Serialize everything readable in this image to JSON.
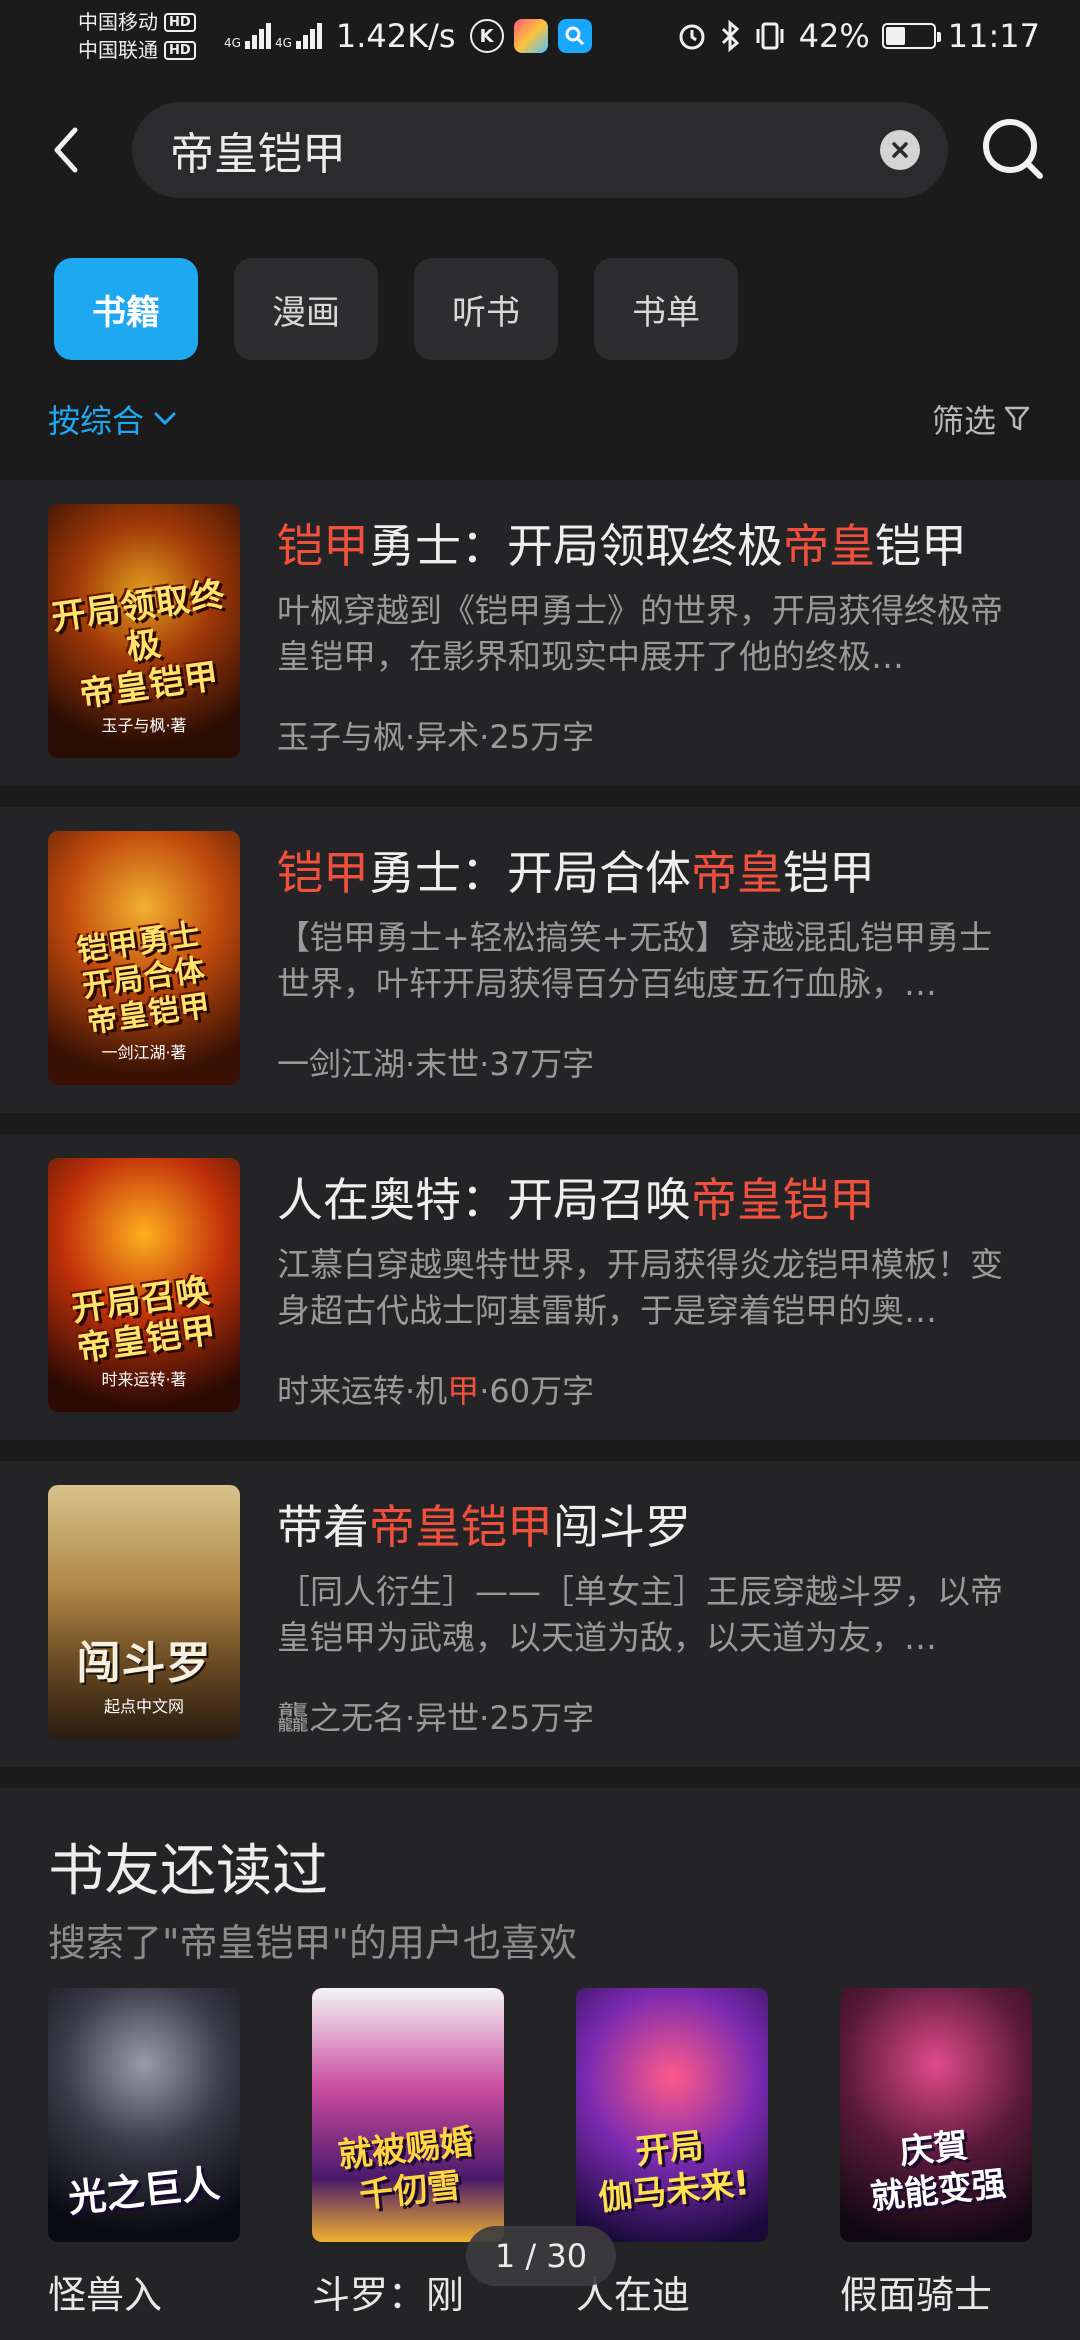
{
  "status_bar": {
    "carrier1": "中国移动",
    "carrier2": "中国联通",
    "hd": "HD",
    "net_type": "4G",
    "net_speed": "1.42K/s",
    "battery_pct": "42%",
    "battery_level": 0.42,
    "time": "11:17"
  },
  "search": {
    "query": "帝皇铠甲"
  },
  "tabs": [
    {
      "label": "书籍"
    },
    {
      "label": "漫画"
    },
    {
      "label": "听书"
    },
    {
      "label": "书单"
    }
  ],
  "sort": {
    "label": "按综合"
  },
  "filter": {
    "label": "筛选"
  },
  "results": [
    {
      "title": [
        {
          "t": "铠甲",
          "hl": true
        },
        {
          "t": "勇士：开局领取终极",
          "hl": false
        },
        {
          "t": "帝皇",
          "hl": true
        },
        {
          "t": "铠甲",
          "hl": false
        }
      ],
      "desc": "叶枫穿越到《铠甲勇士》的世界，开局获得终极帝皇铠甲，在影界和现实中展开了他的终极…",
      "meta": [
        {
          "t": "玉子与枫·异术·25万字",
          "hl": false
        }
      ],
      "cover_text": "开局领取终极\n帝皇铠甲",
      "cover_sub": "玉子与枫·著"
    },
    {
      "title": [
        {
          "t": "铠甲",
          "hl": true
        },
        {
          "t": "勇士：开局合体",
          "hl": false
        },
        {
          "t": "帝皇",
          "hl": true
        },
        {
          "t": "铠甲",
          "hl": false
        }
      ],
      "desc": "【铠甲勇士+轻松搞笑+无敌】穿越混乱铠甲勇士世界，叶轩开局获得百分百纯度五行血脉，…",
      "meta": [
        {
          "t": "一剑江湖·末世·37万字",
          "hl": false
        }
      ],
      "cover_text": "铠甲勇士\n开局合体\n帝皇铠甲",
      "cover_sub": "一剑江湖·著"
    },
    {
      "title": [
        {
          "t": "人在奥特：开局召唤",
          "hl": false
        },
        {
          "t": "帝皇铠甲",
          "hl": true
        }
      ],
      "desc": "江慕白穿越奥特世界，开局获得炎龙铠甲模板！变身超古代战士阿基雷斯，于是穿着铠甲的奥…",
      "meta": [
        {
          "t": "时来运转·机",
          "hl": false
        },
        {
          "t": "甲",
          "hl": true
        },
        {
          "t": "·60万字",
          "hl": false
        }
      ],
      "cover_text": "开局召唤\n帝皇铠甲",
      "cover_sub": "时来运转·著"
    },
    {
      "title": [
        {
          "t": "带着",
          "hl": false
        },
        {
          "t": "帝皇铠甲",
          "hl": true
        },
        {
          "t": "闯斗罗",
          "hl": false
        }
      ],
      "desc": "［同人衍生］——［单女主］王辰穿越斗罗，以帝皇铠甲为武魂，以天道为敌，以天道为友，…",
      "meta": [
        {
          "t": "龘之无名·异世·25万字",
          "hl": false
        }
      ],
      "cover_text": "闯斗罗",
      "cover_sub": "起点中文网"
    }
  ],
  "recommend": {
    "title": "书友还读过",
    "subtitle": "搜索了\"帝皇铠甲\"的用户也喜欢",
    "items": [
      {
        "name": "怪兽入",
        "cover_text": "光之巨人"
      },
      {
        "name": "斗罗：刚",
        "cover_text": "就被赐婚\n千仞雪"
      },
      {
        "name": "人在迪",
        "cover_text": "开局\n伽马未来!"
      },
      {
        "name": "假面骑士",
        "cover_text": "庆賀\n就能变强"
      }
    ]
  },
  "pager": {
    "text": "1 / 30"
  },
  "colors": {
    "accent": "#1ea8f0",
    "highlight": "#f0503c",
    "background": "#1b1b1c",
    "card": "#242426"
  },
  "icons": {
    "back": "chevron-left-icon",
    "clear": "clear-icon",
    "search": "search-icon",
    "sort": "chevron-down-icon",
    "filter": "funnel-icon"
  }
}
